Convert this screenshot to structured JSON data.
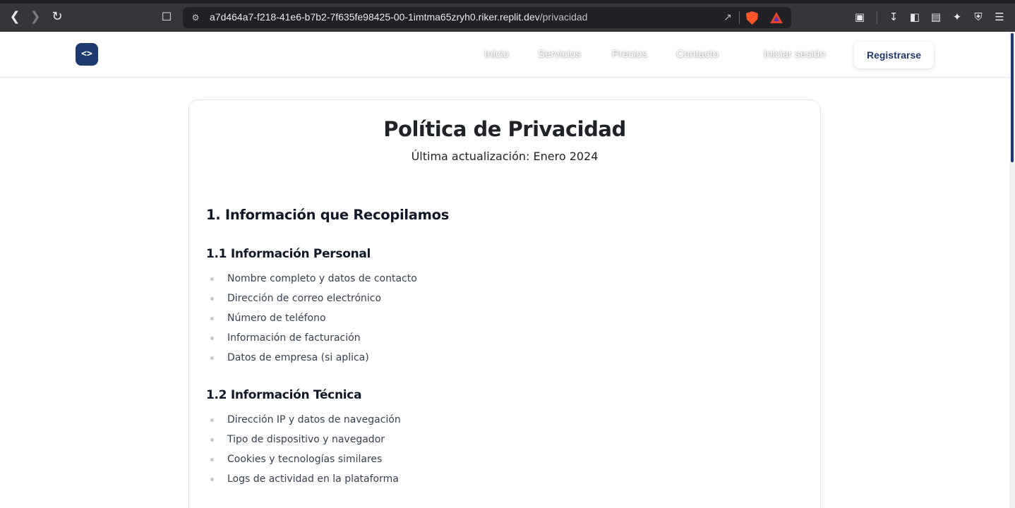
{
  "browser": {
    "url_host": "a7d464a7-f218-41e6-b7b2-7f635fe98425-00-1imtma65zryh0.riker.replit.dev",
    "url_path": "/privacidad"
  },
  "header": {
    "logo_text": "<>",
    "nav": [
      "Inicio",
      "Servicios",
      "Precios",
      "Contacto"
    ],
    "login_label": "Iniciar sesión",
    "register_label": "Registrarse"
  },
  "page": {
    "title": "Política de Privacidad",
    "updated": "Última actualización: Enero 2024",
    "section1": {
      "heading": "1. Información que Recopilamos",
      "sub1": {
        "heading": "1.1 Información Personal",
        "items": [
          "Nombre completo y datos de contacto",
          "Dirección de correo electrónico",
          "Número de teléfono",
          "Información de facturación",
          "Datos de empresa (si aplica)"
        ]
      },
      "sub2": {
        "heading": "1.2 Información Técnica",
        "items": [
          "Dirección IP y datos de navegación",
          "Tipo de dispositivo y navegador",
          "Cookies y tecnologías similares",
          "Logs de actividad en la plataforma"
        ]
      }
    }
  },
  "colors": {
    "brand": "#1e3a6e",
    "text": "#1f2328",
    "bullet": "#c7cbd1"
  }
}
